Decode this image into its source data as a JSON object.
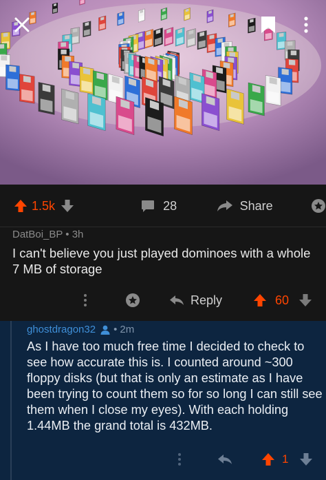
{
  "hero": {
    "description_icon": "floppy-disks-image",
    "icons": {
      "close": "close-icon",
      "save": "bookmark-icon",
      "more": "more-vertical-icon"
    }
  },
  "post_bar": {
    "score": "1.5k",
    "comments_count": "28",
    "share_label": "Share"
  },
  "comment1": {
    "author": "DatBoi_BP",
    "separator": "•",
    "time": "3h",
    "body": "I can't believe you just played dominoes with a whole 7 MB of storage",
    "reply_label": "Reply",
    "score": "60"
  },
  "comment2": {
    "author": "ghostdragon32",
    "separator": "•",
    "time": "2m",
    "body": "As I have too much free time I decided to check to see how accurate this is. I counted around ~300 floppy disks (but that is only an estimate as I have been trying to count them so for so long I can still see them when I close my eyes). With each holding 1.44MB the grand total is 432MB.",
    "score": "1"
  },
  "colors": {
    "upvote": "#ff4500",
    "background": "#161616",
    "highlight": "#0d2540",
    "username_link": "#3f8fd8"
  }
}
